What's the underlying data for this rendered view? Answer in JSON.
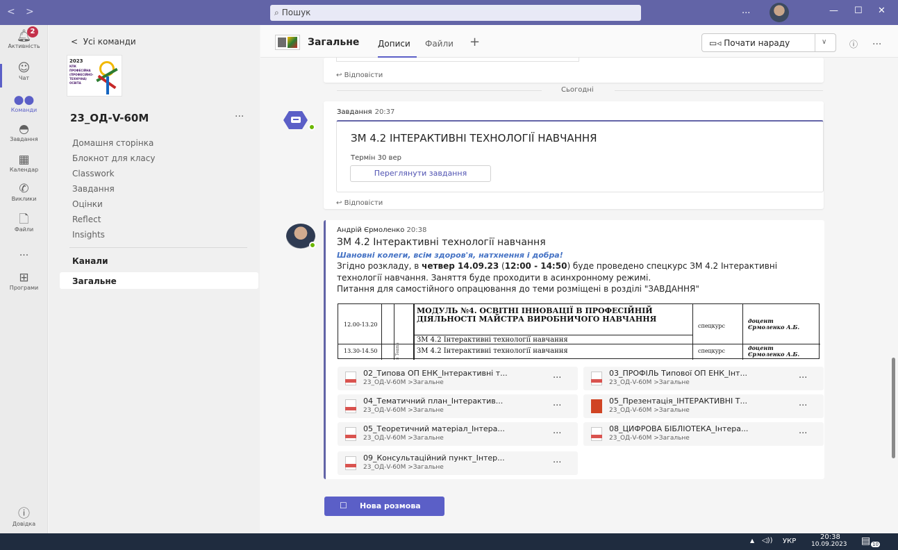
{
  "titlebar": {
    "search_placeholder": "Пошук",
    "more": "...",
    "minimize": "—",
    "maximize": "☐",
    "close": "✕"
  },
  "rail": {
    "activity": {
      "label": "Активність",
      "badge": "2"
    },
    "chat": {
      "label": "Чат"
    },
    "teams": {
      "label": "Команди"
    },
    "assignments": {
      "label": "Завдання"
    },
    "calendar": {
      "label": "Календар"
    },
    "calls": {
      "label": "Виклики"
    },
    "files": {
      "label": "Файли"
    },
    "more": "...",
    "apps": {
      "label": "Програми"
    },
    "help": {
      "label": "Довідка"
    }
  },
  "team_panel": {
    "back_label": "Усі команди",
    "logo_year": "2023",
    "logo_text": "КПК ПРОФЕСІЙНА (ПРОФЕСІЙНО-ТЕХНІЧНА) ОСВІТА",
    "team_name": "23_ОД-V-60М",
    "more": "...",
    "links": [
      "Домашня сторінка",
      "Блокнот для класу",
      "Classwork",
      "Завдання",
      "Оцінки",
      "Reflect",
      "Insights"
    ],
    "channels_title": "Канали",
    "channel_general": "Загальне"
  },
  "header": {
    "channel_name": "Загальне",
    "tab_posts": "Дописи",
    "tab_files": "Файли",
    "add_tab": "+",
    "meet_button": "Почати нараду",
    "more": "..."
  },
  "feed": {
    "reply_label": "Відповісти",
    "today": "Сьогодні",
    "task_post": {
      "author": "Завдання",
      "time": "20:37",
      "title": "ЗМ 4.2 ІНТЕРАКТИВНІ ТЕХНОЛОГІЇ НАВЧАННЯ",
      "due": "Термін 30 вер",
      "button": "Переглянути завдання"
    },
    "post": {
      "author": "Андрій Єрмоленко",
      "time": "20:38",
      "title": "ЗМ 4.2 Інтерактивні технології навчання",
      "greeting": "Шановні колеги, всім здоров'я, натхнення і добра!",
      "line1_a": "Згідно розкладу, в ",
      "line1_b": "четвер 14.09.23",
      "line1_c": " (",
      "line1_d": "12:00 - 14:50",
      "line1_e": ") буде проведено спецкурс ЗМ 4.2 Інтерактивні",
      "line2": "технології навчання. Заняття буде проходити в асинхронному режимі.",
      "line3": "Питання для самостійного опрацювання до теми розміщені в розділі \"ЗАВДАННЯ\"",
      "schedule": {
        "heading": "МОДУЛЬ №4. ОСВІТНІ ІННОВАЦІЇ В ПРОФЕСІЙНІЙ ДІЯЛЬНОСТІ МАЙСТРА ВИРОБНИЧОГО НАВЧАННЯ",
        "subject1": "ЗМ 4.2 Інтерактивні технології навчання",
        "subject2": "ЗМ 4.2 Інтерактивні технології навчання",
        "time1": "12.00-13.20",
        "time2": "13.30-14.50",
        "type1": "спецкурс",
        "type2": "спецкурс",
        "teacher1_role": "доцент",
        "teacher1_name": "Єрмоленко А.Б.",
        "teacher2_role": "доцент",
        "teacher2_name": "Єрмоленко А.Б.",
        "side_label": "в Teams"
      },
      "attachments": [
        {
          "name": "02_Типова ОП ЕНК_Інтерактивні т...",
          "path": "23_ОД-V-60М >Загальне",
          "type": "pdf"
        },
        {
          "name": "03_ПРОФІЛЬ Типової ОП ЕНК_Інт...",
          "path": "23_ОД-V-60М >Загальне",
          "type": "pdf"
        },
        {
          "name": "04_Тематичний план_Інтерактив...",
          "path": "23_ОД-V-60М >Загальне",
          "type": "pdf"
        },
        {
          "name": "05_Презентація_ІНТЕРАКТИВНІ Т...",
          "path": "23_ОД-V-60М >Загальне",
          "type": "ppt"
        },
        {
          "name": "05_Теоретичний матеріал_Інтера...",
          "path": "23_ОД-V-60М >Загальне",
          "type": "pdf"
        },
        {
          "name": "08_ЦИФРОВА БІБЛІОТЕКА_Інтера...",
          "path": "23_ОД-V-60М >Загальне",
          "type": "pdf"
        },
        {
          "name": "09_Консультаційний пункт_Інтер...",
          "path": "23_ОД-V-60М >Загальне",
          "type": "pdf"
        }
      ],
      "attachment_more": "..."
    },
    "new_conversation": "Нова розмова"
  },
  "taskbar": {
    "lang": "УКР",
    "time": "20:38",
    "date": "10.09.2023",
    "notif": "10"
  }
}
